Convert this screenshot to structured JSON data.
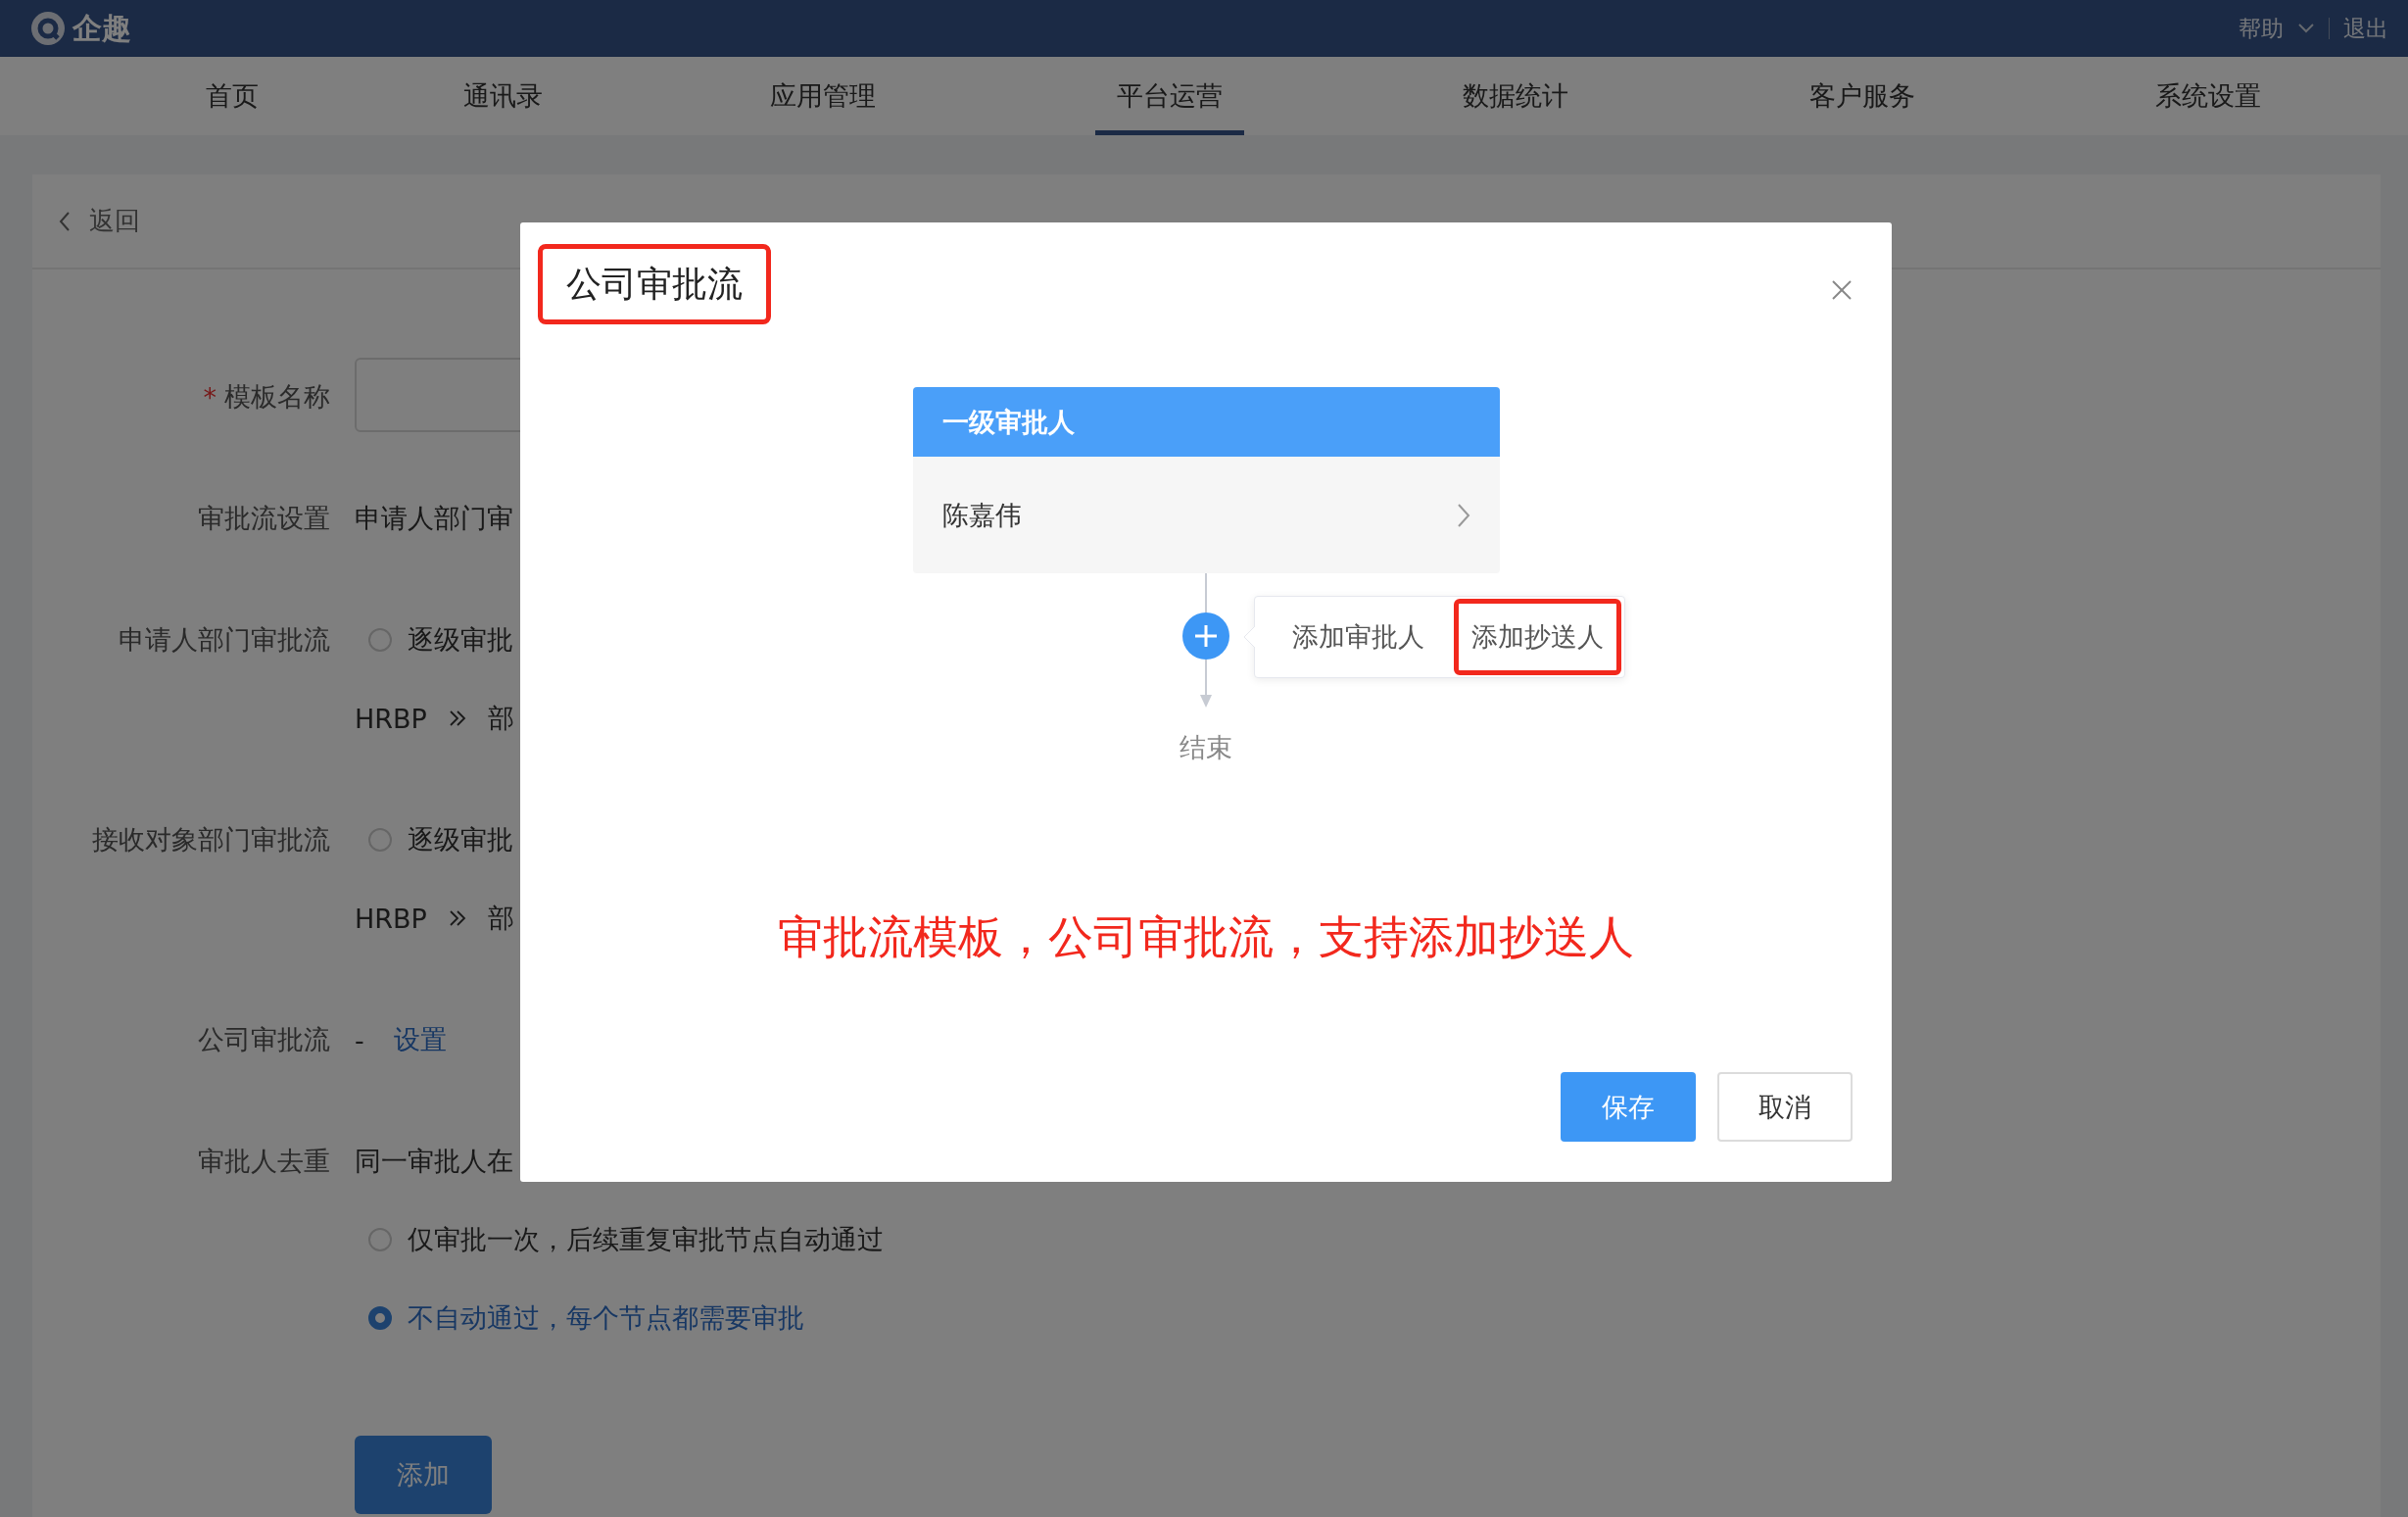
{
  "top_bar": {
    "logo": "企趣",
    "help": "帮助",
    "logout": "退出"
  },
  "nav": [
    {
      "label": "首页",
      "selected": false
    },
    {
      "label": "通讯录",
      "selected": false
    },
    {
      "label": "应用管理",
      "selected": false
    },
    {
      "label": "平台运营",
      "selected": true
    },
    {
      "label": "数据统计",
      "selected": false
    },
    {
      "label": "客户服务",
      "selected": false
    },
    {
      "label": "系统设置",
      "selected": false
    }
  ],
  "page": {
    "back": "返回",
    "form": [
      {
        "kind": "input",
        "label": "模板名称",
        "required_mark": "*"
      },
      {
        "kind": "text",
        "label": "审批流设置",
        "value": "申请人部门审"
      },
      {
        "kind": "radio",
        "label": "申请人部门审批流",
        "options": [
          {
            "label": "逐级审批",
            "selected": false
          }
        ],
        "chain": [
          "HRBP",
          "部"
        ]
      },
      {
        "kind": "radio",
        "label": "接收对象部门审批流",
        "options": [
          {
            "label": "逐级审批",
            "selected": false
          }
        ],
        "chain": [
          "HRBP",
          "部"
        ]
      },
      {
        "kind": "link",
        "label": "公司审批流",
        "value": "-",
        "link": "设置"
      },
      {
        "kind": "radio",
        "label": "审批人去重",
        "value": "同一审批人在",
        "options": [
          {
            "label": "仅审批一次，后续重复审批节点自动通过",
            "selected": false
          },
          {
            "label": "不自动通过，每个节点都需要审批",
            "selected": true
          }
        ]
      }
    ],
    "submit": "添加"
  },
  "modal": {
    "title": "公司审批流",
    "title_highlighted": true,
    "node": {
      "header": "一级审批人",
      "approver": "陈嘉伟"
    },
    "popover": [
      {
        "label": "添加审批人",
        "highlighted": false
      },
      {
        "label": "添加抄送人",
        "highlighted": true
      }
    ],
    "end": "结束",
    "annotation": "审批流模板，公司审批流，支持添加抄送人",
    "buttons": [
      {
        "label": "保存",
        "kind": "primary"
      },
      {
        "label": "取消",
        "kind": "default"
      }
    ]
  }
}
